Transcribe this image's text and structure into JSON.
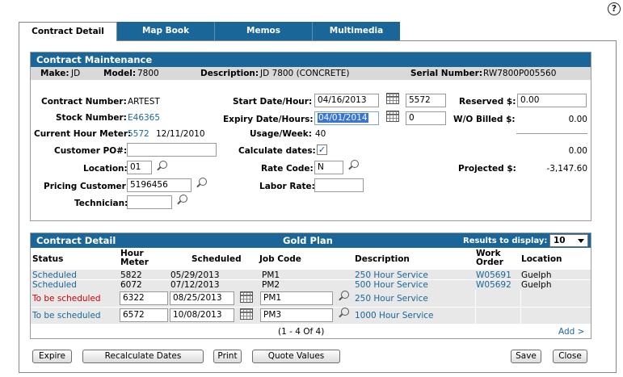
{
  "help_label": "?",
  "tabs": [
    {
      "label": "Contract Detail",
      "active": true
    },
    {
      "label": "Map Book",
      "active": false
    },
    {
      "label": "Memos",
      "active": false
    },
    {
      "label": "Multimedia",
      "active": false
    }
  ],
  "maintenance": {
    "title": "Contract Maintenance",
    "make_label": "Make:",
    "make": "JD",
    "model_label": "Model:",
    "model": "7800",
    "description_label": "Description:",
    "description": "JD 7800 (CONCRETE)",
    "serial_label": "Serial Number:",
    "serial": "RW7800P005560",
    "contract_number_label": "Contract Number:",
    "contract_number": "ARTEST",
    "stock_number_label": "Stock Number:",
    "stock_number": "E46365",
    "current_meter_label": "Current Hour Meter:",
    "current_meter": "5572",
    "current_meter_date": "12/11/2010",
    "customer_po_label": "Customer PO#:",
    "customer_po": "",
    "location_label": "Location:",
    "location": "01",
    "pricing_customer_label": "Pricing Customer:",
    "pricing_customer": "5196456",
    "technician_label": "Technician:",
    "technician": "",
    "start_label": "Start Date/Hour:",
    "start_date": "04/16/2013",
    "start_hour": "5572",
    "expiry_label": "Expiry Date/Hours:",
    "expiry_date": "04/01/2014",
    "expiry_hours": "0",
    "usage_label": "Usage/Week:",
    "usage": "40",
    "calculate_label": "Calculate dates:",
    "calculate_checked": true,
    "check_glyph": "✓",
    "rate_code_label": "Rate Code:",
    "rate_code": "N",
    "labor_rate_label": "Labor Rate:",
    "labor_rate": "",
    "reserved_label": "Reserved $:",
    "reserved": "0.00",
    "wo_billed_label": "W/O Billed $:",
    "wo_billed": "0.00",
    "blank_total": "0.00",
    "projected_label": "Projected $:",
    "projected": "-3,147.60"
  },
  "detail": {
    "title": "Contract Detail",
    "plan": "Gold Plan",
    "results_label": "Results to display:",
    "results_value": "10",
    "columns": {
      "status": "Status",
      "hour_meter_1": "Hour",
      "hour_meter_2": "Meter",
      "scheduled": "Scheduled",
      "job_code": "Job Code",
      "description": "Description",
      "work_order_1": "Work",
      "work_order_2": "Order",
      "location": "Location"
    },
    "rows": [
      {
        "status": "Scheduled",
        "hour_meter": "5822",
        "scheduled": "05/29/2013",
        "job_code": "PM1",
        "description": "250 Hour Service",
        "work_order": "W05691",
        "location": "Guelph"
      },
      {
        "status": "Scheduled",
        "hour_meter": "6072",
        "scheduled": "07/12/2013",
        "job_code": "PM2",
        "description": "500 Hour Service",
        "work_order": "W05692",
        "location": "Guelph"
      },
      {
        "status": "To be scheduled",
        "hour_meter": "6322",
        "scheduled": "08/25/2013",
        "job_code": "PM1",
        "description": "250 Hour Service",
        "work_order": "",
        "location": ""
      },
      {
        "status": "To be scheduled",
        "hour_meter": "6572",
        "scheduled": "10/08/2013",
        "job_code": "PM3",
        "description": "1000 Hour Service",
        "work_order": "",
        "location": ""
      }
    ],
    "pagination": "(1 - 4 Of 4)",
    "add_label": "Add >"
  },
  "buttons": {
    "expire": "Expire",
    "recalculate": "Recalculate Dates",
    "print": "Print",
    "quote": "Quote Values",
    "save": "Save",
    "close": "Close"
  },
  "colors": {
    "header_blue": "#1a6699",
    "link_blue": "#1a6699",
    "warning_red": "#cc0000"
  }
}
